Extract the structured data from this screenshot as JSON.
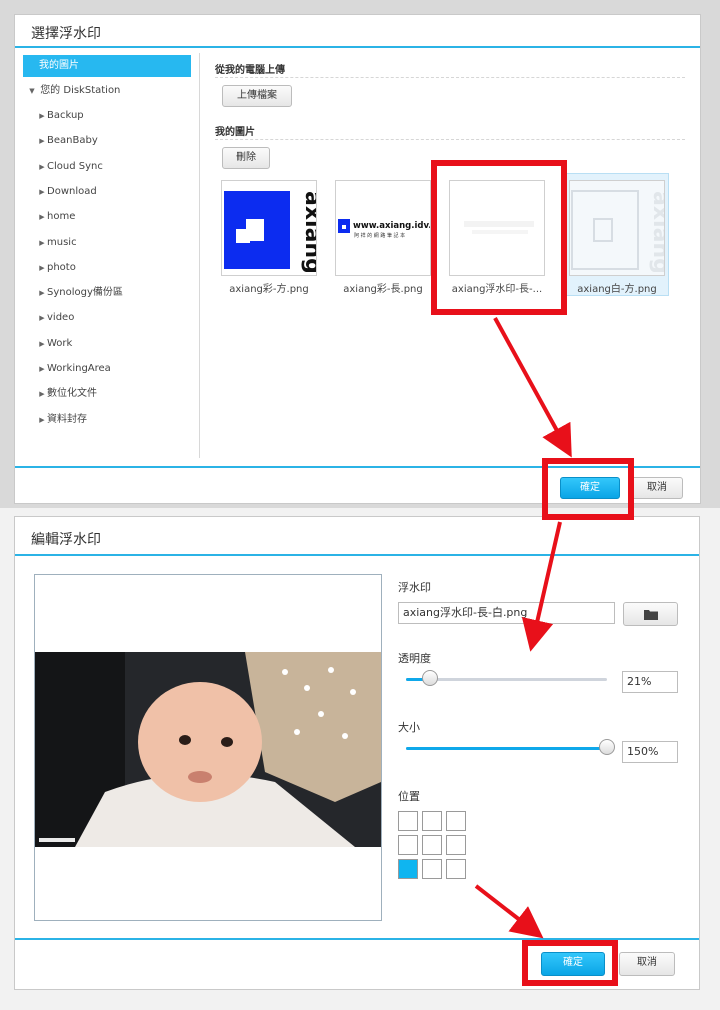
{
  "dialog1": {
    "title": "選擇浮水印",
    "sidebar": {
      "selected": "我的圖片",
      "root": "您的 DiskStation",
      "folders": [
        "Backup",
        "BeanBaby",
        "Cloud Sync",
        "Download",
        "home",
        "music",
        "photo",
        "Synology備份區",
        "video",
        "Work",
        "WorkingArea",
        "數位化文件",
        "資料封存"
      ]
    },
    "upload_section": {
      "heading": "從我的電腦上傳",
      "button": "上傳檔案"
    },
    "images_section": {
      "heading": "我的圖片",
      "delete_button": "刪除",
      "thumbnails": [
        {
          "label": "axiang彩-方.png",
          "logo_text": "axiang"
        },
        {
          "label": "axiang彩-長.png",
          "logo_text": "www.axiang.idv.tw",
          "sub_text": "阿 祥 的 網 路 筆 記 本"
        },
        {
          "label": "axiang浮水印-長-...",
          "logo_text": ""
        },
        {
          "label": "axiang白-方.png",
          "logo_text": "axiang"
        }
      ]
    },
    "ok_button": "確定",
    "cancel_button": "取消"
  },
  "dialog2": {
    "title": "編輯浮水印",
    "watermark": {
      "label": "浮水印",
      "value": "axiang浮水印-長-白.png",
      "icon": "folder-icon"
    },
    "opacity": {
      "label": "透明度",
      "value": "21%",
      "level": 0.12
    },
    "size": {
      "label": "大小",
      "value": "150%",
      "level": 1.0
    },
    "position": {
      "label": "位置",
      "selected_row": 2,
      "selected_col": 0
    },
    "ok_button": "確定",
    "cancel_button": "取消"
  },
  "colors": {
    "accent": "#2bb3e6",
    "highlight": "#e8101a",
    "primary_button": "#0fa8ea"
  }
}
